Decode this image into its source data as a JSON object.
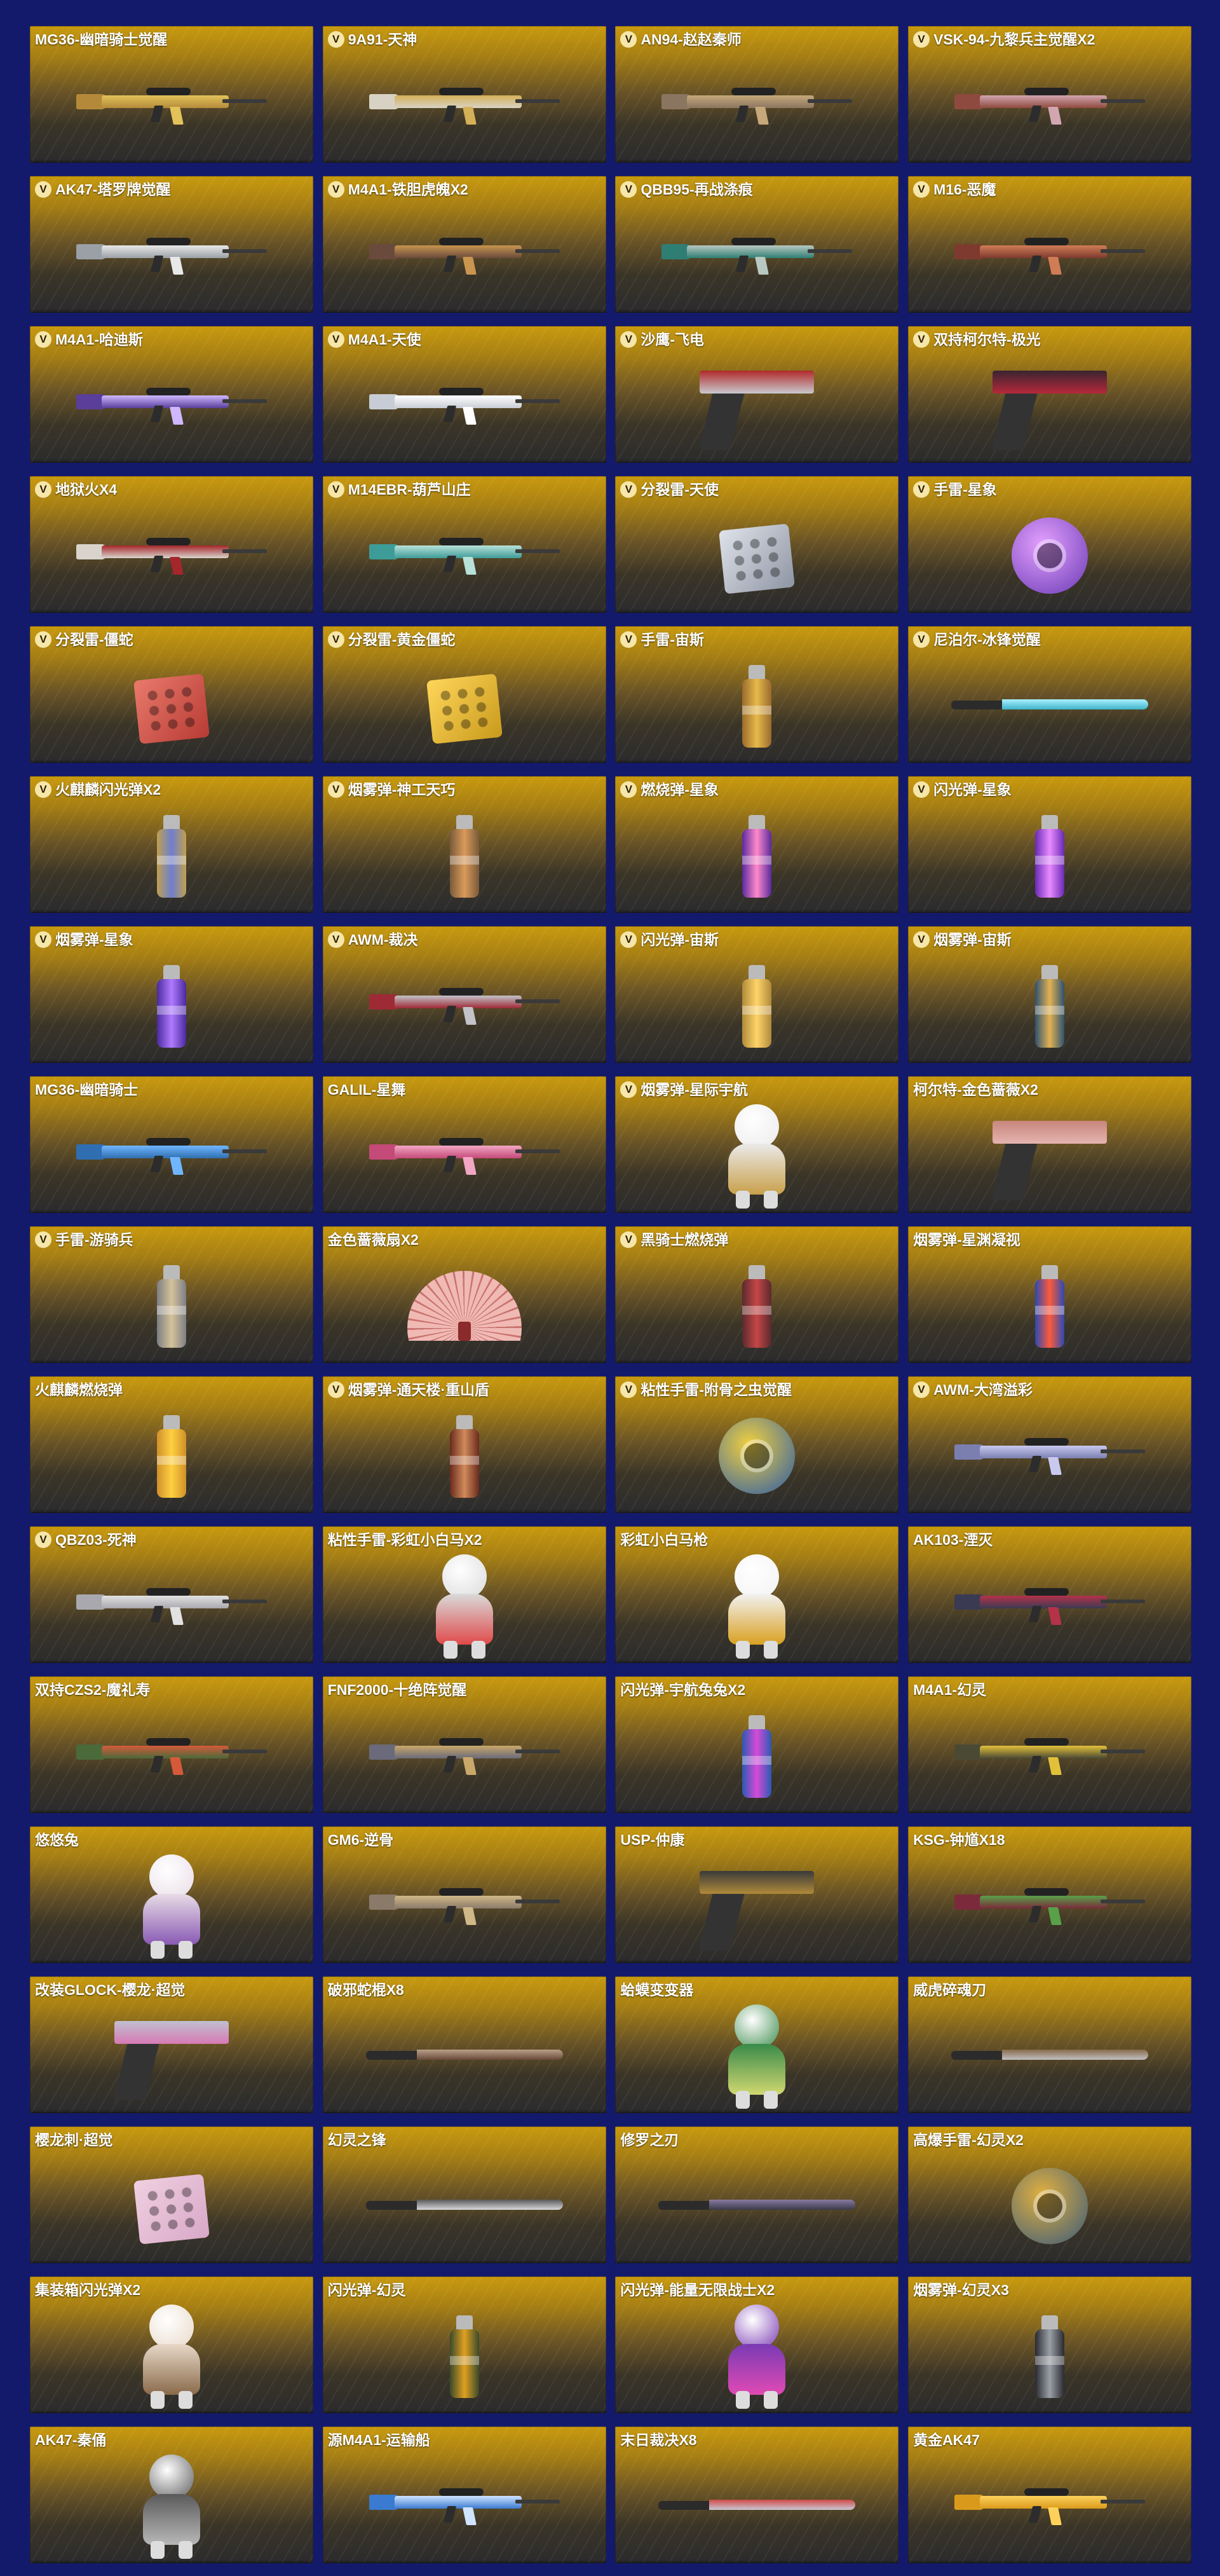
{
  "colors": {
    "page_background": "#141a6b",
    "card_top": "#c99a0e",
    "card_bottom": "#2b2b2d",
    "vip_badge": "#f6e6a8"
  },
  "items": [
    {
      "name": "MG36-幽暗骑士觉醒",
      "vip": false,
      "kind": "gun",
      "color": "#b48a3a",
      "accent": "#e3c25a"
    },
    {
      "name": "9A91-天神",
      "vip": true,
      "kind": "gun",
      "color": "#d8d2c4",
      "accent": "#d4b058"
    },
    {
      "name": "AN94-赵赵秦师",
      "vip": true,
      "kind": "gun",
      "color": "#8a7560",
      "accent": "#c7a87a"
    },
    {
      "name": "VSK-94-九黎兵主觉醒X2",
      "vip": true,
      "kind": "gun",
      "color": "#8e4a3e",
      "accent": "#d1a6b0"
    },
    {
      "name": "AK47-塔罗牌觉醒",
      "vip": true,
      "kind": "gun",
      "color": "#9aa0a6",
      "accent": "#e8e8e8"
    },
    {
      "name": "M4A1-铁胆虎魄X2",
      "vip": true,
      "kind": "gun",
      "color": "#6a4a3c",
      "accent": "#c9954f"
    },
    {
      "name": "QBB95-再战涤痕",
      "vip": true,
      "kind": "gun",
      "color": "#2f7e73",
      "accent": "#b8c8c2"
    },
    {
      "name": "M16-恶魔",
      "vip": true,
      "kind": "gun",
      "color": "#7e3a2e",
      "accent": "#d07c56"
    },
    {
      "name": "M4A1-哈迪斯",
      "vip": true,
      "kind": "gun",
      "color": "#5a3e9a",
      "accent": "#cfb8ff"
    },
    {
      "name": "M4A1-天使",
      "vip": true,
      "kind": "gun",
      "color": "#c8ccd4",
      "accent": "#ffffff"
    },
    {
      "name": "沙鹰-飞电",
      "vip": true,
      "kind": "pistol",
      "color": "#c9c9cf",
      "accent": "#b02a2a"
    },
    {
      "name": "双持柯尔特-极光",
      "vip": true,
      "kind": "pistol",
      "color": "#b5283a",
      "accent": "#3a2430"
    },
    {
      "name": "地狱火X4",
      "vip": true,
      "kind": "gun",
      "color": "#d8d4cc",
      "accent": "#a5262b"
    },
    {
      "name": "M14EBR-葫芦山庄",
      "vip": true,
      "kind": "gun",
      "color": "#3e9c98",
      "accent": "#b7e1d9"
    },
    {
      "name": "分裂雷-天使",
      "vip": true,
      "kind": "box",
      "color": "#8e95a3",
      "accent": "#dfe3ea"
    },
    {
      "name": "手雷-星象",
      "vip": true,
      "kind": "blob",
      "color": "#6a3ab4",
      "accent": "#e3a0ff"
    },
    {
      "name": "分裂雷-僵蛇",
      "vip": true,
      "kind": "box",
      "color": "#b83b34",
      "accent": "#e97a6c"
    },
    {
      "name": "分裂雷-黄金僵蛇",
      "vip": true,
      "kind": "box",
      "color": "#c99a1c",
      "accent": "#ffd65a"
    },
    {
      "name": "手雷-宙斯",
      "vip": true,
      "kind": "grenade",
      "color": "#9a6b2d",
      "accent": "#e7b94a"
    },
    {
      "name": "尼泊尔-冰锋觉醒",
      "vip": true,
      "kind": "knife",
      "color": "#3fb3c9",
      "accent": "#a9f0ff"
    },
    {
      "name": "火麒麟闪光弹X2",
      "vip": true,
      "kind": "grenade",
      "color": "#c0a050",
      "accent": "#6e7fd0"
    },
    {
      "name": "烟雾弹-神工天巧",
      "vip": true,
      "kind": "grenade",
      "color": "#7a5a3a",
      "accent": "#d99a5a"
    },
    {
      "name": "燃烧弹-星象",
      "vip": true,
      "kind": "grenade",
      "color": "#5a2aa0",
      "accent": "#ff89c9"
    },
    {
      "name": "闪光弹-星象",
      "vip": true,
      "kind": "grenade",
      "color": "#6a2ab4",
      "accent": "#e78bff"
    },
    {
      "name": "烟雾弹-星象",
      "vip": true,
      "kind": "grenade",
      "color": "#4a2aa0",
      "accent": "#b07bff"
    },
    {
      "name": "AWM-裁决",
      "vip": true,
      "kind": "gun",
      "color": "#9e2a36",
      "accent": "#c2c2c8"
    },
    {
      "name": "闪光弹-宙斯",
      "vip": true,
      "kind": "grenade",
      "color": "#b08a3a",
      "accent": "#ffd469"
    },
    {
      "name": "烟雾弹-宙斯",
      "vip": true,
      "kind": "grenade",
      "color": "#2f5270",
      "accent": "#e2b252"
    },
    {
      "name": "MG36-幽暗骑士",
      "vip": false,
      "kind": "gun",
      "color": "#2f6fb1",
      "accent": "#6fb6ff"
    },
    {
      "name": "GALIL-星舞",
      "vip": false,
      "kind": "gun",
      "color": "#c44a78",
      "accent": "#f2a6c4"
    },
    {
      "name": "烟雾弹-星际宇航",
      "vip": true,
      "kind": "fig",
      "color": "#eaeaea",
      "accent": "#c9a04a"
    },
    {
      "name": "柯尔特-金色蔷薇X2",
      "vip": false,
      "kind": "pistol",
      "color": "#e5b4b0",
      "accent": "#c7867c"
    },
    {
      "name": "手雷-游骑兵",
      "vip": true,
      "kind": "grenade",
      "color": "#7c7f86",
      "accent": "#d6c29a"
    },
    {
      "name": "金色蔷薇扇X2",
      "vip": false,
      "kind": "fan",
      "color": "#f0b9b4",
      "accent": "#8a2a2a"
    },
    {
      "name": "黑骑士燃烧弹",
      "vip": true,
      "kind": "grenade",
      "color": "#5a2a2e",
      "accent": "#c64646"
    },
    {
      "name": "烟雾弹-星渊凝视",
      "vip": false,
      "kind": "grenade",
      "color": "#2a4ab4",
      "accent": "#ff5a3a"
    },
    {
      "name": "火麒麟燃烧弹",
      "vip": false,
      "kind": "grenade",
      "color": "#d0902a",
      "accent": "#ffd040"
    },
    {
      "name": "烟雾弹-通天楼·重山盾",
      "vip": true,
      "kind": "grenade",
      "color": "#6a2a1e",
      "accent": "#d08a5a"
    },
    {
      "name": "粘性手雷-附骨之虫觉醒",
      "vip": true,
      "kind": "blob",
      "color": "#2a5aa8",
      "accent": "#f0d040"
    },
    {
      "name": "AWM-大湾溢彩",
      "vip": true,
      "kind": "gun",
      "color": "#7a7fb0",
      "accent": "#c9c9f0"
    },
    {
      "name": "QBZ03-死神",
      "vip": true,
      "kind": "gun",
      "color": "#a8a8ae",
      "accent": "#e2e2e2"
    },
    {
      "name": "粘性手雷-彩虹小白马X2",
      "vip": false,
      "kind": "fig",
      "color": "#dadada",
      "accent": "#e04a4a"
    },
    {
      "name": "彩虹小白马枪",
      "vip": false,
      "kind": "fig",
      "color": "#f2f2f2",
      "accent": "#d9a020"
    },
    {
      "name": "AK103-湮灭",
      "vip": false,
      "kind": "gun",
      "color": "#3a3a52",
      "accent": "#b4324a"
    },
    {
      "name": "双持CZS2-魔礼寿",
      "vip": false,
      "kind": "gun",
      "color": "#4a6a3a",
      "accent": "#d45a3a"
    },
    {
      "name": "FNF2000-十绝阵觉醒",
      "vip": false,
      "kind": "gun",
      "color": "#6a6a7a",
      "accent": "#c9a86a"
    },
    {
      "name": "闪光弹-宇航兔兔X2",
      "vip": false,
      "kind": "grenade",
      "color": "#2a5ab4",
      "accent": "#d64ad8"
    },
    {
      "name": "M4A1-幻灵",
      "vip": false,
      "kind": "gun",
      "color": "#4a4a34",
      "accent": "#e2c03a"
    },
    {
      "name": "悠悠兔",
      "vip": false,
      "kind": "fig",
      "color": "#e8dce6",
      "accent": "#8a5ab4"
    },
    {
      "name": "GM6-逆骨",
      "vip": false,
      "kind": "gun",
      "color": "#8a7a6a",
      "accent": "#d0b888"
    },
    {
      "name": "USP-仲康",
      "vip": false,
      "kind": "pistol",
      "color": "#b08a3a",
      "accent": "#3a3a3a"
    },
    {
      "name": "KSG-钟馗X18",
      "vip": false,
      "kind": "gun",
      "color": "#7a2a3a",
      "accent": "#5aa04a"
    },
    {
      "name": "改装GLOCK-樱龙·超觉",
      "vip": false,
      "kind": "pistol",
      "color": "#d67ab4",
      "accent": "#c0c0d0"
    },
    {
      "name": "破邪蛇棍X8",
      "vip": false,
      "kind": "knife",
      "color": "#6a4a3a",
      "accent": "#b8a08a"
    },
    {
      "name": "蛤蟆变变器",
      "vip": false,
      "kind": "fig",
      "color": "#3a8a4a",
      "accent": "#d0d870"
    },
    {
      "name": "威虎碎魂刀",
      "vip": false,
      "kind": "knife",
      "color": "#c0c0c4",
      "accent": "#8a6a4a"
    },
    {
      "name": "樱龙刺·超觉",
      "vip": false,
      "kind": "box",
      "color": "#d8a8c8",
      "accent": "#f0d0e0"
    },
    {
      "name": "幻灵之锋",
      "vip": false,
      "kind": "knife",
      "color": "#d8d8dc",
      "accent": "#5a5a5a"
    },
    {
      "name": "修罗之刃",
      "vip": false,
      "kind": "knife",
      "color": "#3a3a4a",
      "accent": "#8a7aa0"
    },
    {
      "name": "高爆手雷-幻灵X2",
      "vip": false,
      "kind": "blob",
      "color": "#3a5a7a",
      "accent": "#e0b040"
    },
    {
      "name": "集装箱闪光弹X2",
      "vip": false,
      "kind": "fig",
      "color": "#e8d8c8",
      "accent": "#8a6a4a"
    },
    {
      "name": "闪光弹-幻灵",
      "vip": false,
      "kind": "grenade",
      "color": "#3a4a2a",
      "accent": "#e0a020"
    },
    {
      "name": "闪光弹-能量无限战士X2",
      "vip": false,
      "kind": "fig",
      "color": "#7a3ab4",
      "accent": "#e04ab4"
    },
    {
      "name": "烟雾弹-幻灵X3",
      "vip": false,
      "kind": "grenade",
      "color": "#2a2a30",
      "accent": "#9aa0a8"
    },
    {
      "name": "AK47-秦俑",
      "vip": false,
      "kind": "fig",
      "color": "#5a5a5a",
      "accent": "#b8b8b8"
    },
    {
      "name": "源M4A1-运输船",
      "vip": false,
      "kind": "gun",
      "color": "#3a7ad0",
      "accent": "#d0e4ff"
    },
    {
      "name": "末日裁决X8",
      "vip": false,
      "kind": "knife",
      "color": "#c8c8d4",
      "accent": "#d04a4a"
    },
    {
      "name": "黄金AK47",
      "vip": false,
      "kind": "gun",
      "color": "#d99a1c",
      "accent": "#ffd15a"
    }
  ]
}
